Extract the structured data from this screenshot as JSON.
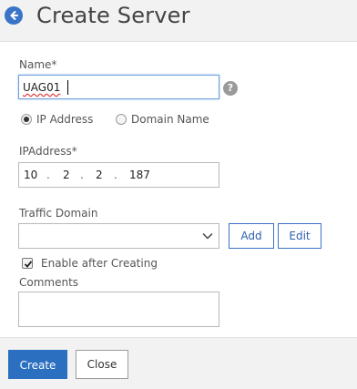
{
  "header": {
    "title": "Create Server",
    "back_icon": "back-arrow-icon"
  },
  "form": {
    "name_label": "Name*",
    "name_value": "UAG01",
    "help_icon_text": "?",
    "radio_ip_label": "IP Address",
    "radio_domain_label": "Domain Name",
    "selected_address_type": "IP Address",
    "ipaddress_label": "IPAddress*",
    "ip_octets": [
      "10",
      "2",
      "2",
      "187"
    ],
    "traffic_domain_label": "Traffic Domain",
    "traffic_domain_value": "",
    "add_label": "Add",
    "edit_label": "Edit",
    "enable_label": "Enable after Creating",
    "enable_checked": true,
    "comments_label": "Comments",
    "comments_value": ""
  },
  "footer": {
    "create_label": "Create",
    "close_label": "Close"
  },
  "colors": {
    "accent": "#2a6fc0",
    "back_button": "#3a73c7",
    "focus_border": "#6d9fde"
  }
}
